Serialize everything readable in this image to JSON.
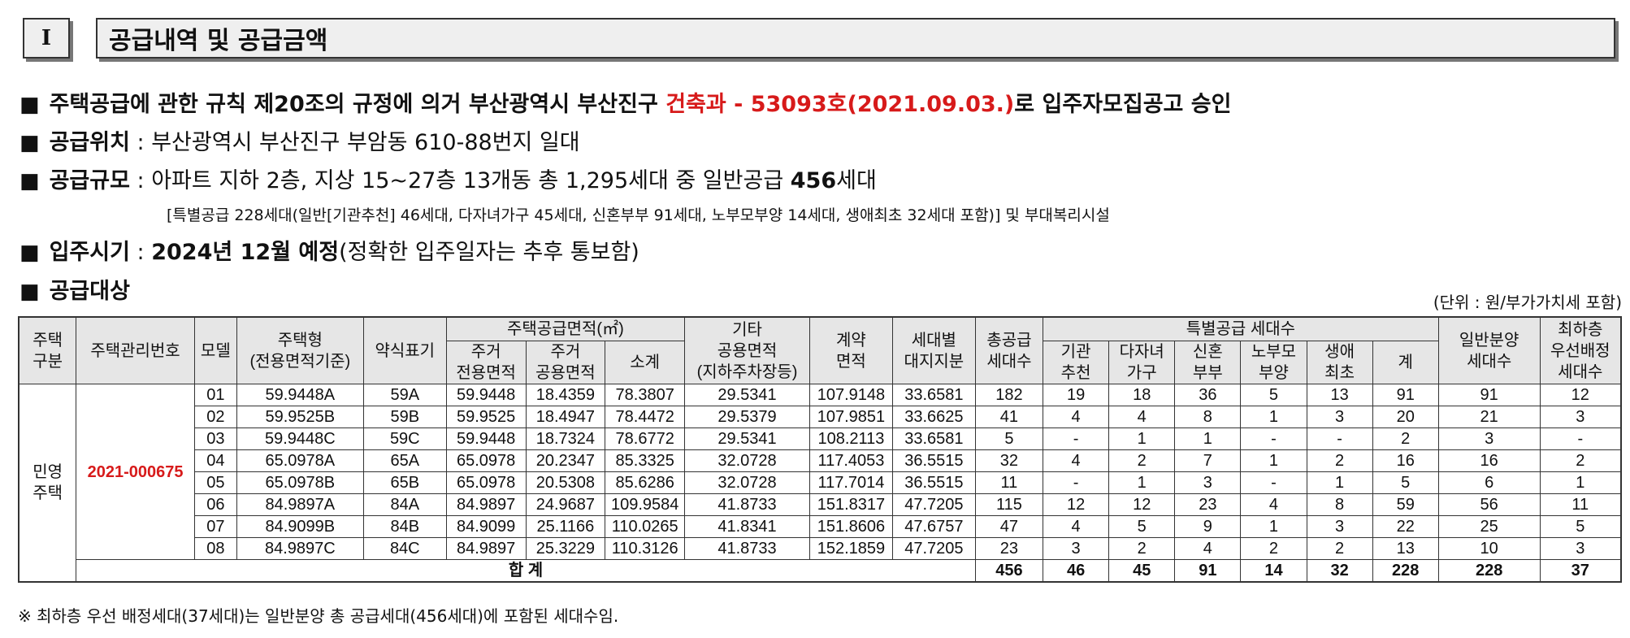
{
  "header": {
    "num": "I",
    "title": "공급내역 및 공급금액"
  },
  "lines": {
    "approval_pre": "주택공급에 관한 규칙 제20조의 규정에 의거 부산광역시 부산진구 ",
    "approval_red": "건축과 - 53093호(2021.09.03.)",
    "approval_post": "로 입주자모집공고 승인",
    "loc_label": "공급위치",
    "loc_text": " : 부산광역시 부산진구 부암동 610-88번지 일대",
    "scale_label": "공급규모",
    "scale_text": " : 아파트 지하 2층, 지상 15~27층 13개동 총 1,295세대 중 일반공급 ",
    "scale_bold": "456",
    "scale_end": "세대",
    "scale_sub": "[특별공급 228세대(일반[기관추천] 46세대, 다자녀가구 45세대, 신혼부부 91세대, 노부모부양 14세대, 생애최초 32세대 포함)] 및 부대복리시설",
    "move_label": "입주시기",
    "move_pre": " : ",
    "move_bold": "2024년 12월 예정",
    "move_text": "(정확한 입주일자는 추후 통보함)",
    "target_label": "공급대상",
    "unit": "(단위 : 원/부가가치세 포함)",
    "square": "■"
  },
  "table": {
    "h": {
      "house_type": "주택\n구분",
      "mgmt_no": "주택관리번호",
      "model": "모델",
      "type": "주택형\n(전용면적기준)",
      "short": "약식표기",
      "area_group": "주택공급면적(㎡)",
      "excl": "주거\n전용면적",
      "common": "주거\n공용면적",
      "subtotal": "소계",
      "other": "기타\n공용면적\n(지하주차장등)",
      "contract": "계약\n면적",
      "land": "세대별\n대지지분",
      "total": "총공급\n세대수",
      "special_group": "특별공급 세대수",
      "inst": "기관\n추천",
      "multi": "다자녀\n가구",
      "newlywed": "신혼\n부부",
      "elder": "노부모\n부양",
      "first": "생애\n최초",
      "sum": "계",
      "general": "일반분양\n세대수",
      "lowest": "최하층\n우선배정\n세대수"
    },
    "house_type": "민영\n주택",
    "mgmt_no": "2021-000675",
    "rows": [
      [
        "01",
        "59.9448A",
        "59A",
        "59.9448",
        "18.4359",
        "78.3807",
        "29.5341",
        "107.9148",
        "33.6581",
        "182",
        "19",
        "18",
        "36",
        "5",
        "13",
        "91",
        "91",
        "12"
      ],
      [
        "02",
        "59.9525B",
        "59B",
        "59.9525",
        "18.4947",
        "78.4472",
        "29.5379",
        "107.9851",
        "33.6625",
        "41",
        "4",
        "4",
        "8",
        "1",
        "3",
        "20",
        "21",
        "3"
      ],
      [
        "03",
        "59.9448C",
        "59C",
        "59.9448",
        "18.7324",
        "78.6772",
        "29.5341",
        "108.2113",
        "33.6581",
        "5",
        "-",
        "1",
        "1",
        "-",
        "-",
        "2",
        "3",
        "-"
      ],
      [
        "04",
        "65.0978A",
        "65A",
        "65.0978",
        "20.2347",
        "85.3325",
        "32.0728",
        "117.4053",
        "36.5515",
        "32",
        "4",
        "2",
        "7",
        "1",
        "2",
        "16",
        "16",
        "2"
      ],
      [
        "05",
        "65.0978B",
        "65B",
        "65.0978",
        "20.5308",
        "85.6286",
        "32.0728",
        "117.7014",
        "36.5515",
        "11",
        "-",
        "1",
        "3",
        "-",
        "1",
        "5",
        "6",
        "1"
      ],
      [
        "06",
        "84.9897A",
        "84A",
        "84.9897",
        "24.9687",
        "109.9584",
        "41.8733",
        "151.8317",
        "47.7205",
        "115",
        "12",
        "12",
        "23",
        "4",
        "8",
        "59",
        "56",
        "11"
      ],
      [
        "07",
        "84.9099B",
        "84B",
        "84.9099",
        "25.1166",
        "110.0265",
        "41.8341",
        "151.8606",
        "47.6757",
        "47",
        "4",
        "5",
        "9",
        "1",
        "3",
        "22",
        "25",
        "5"
      ],
      [
        "08",
        "84.9897C",
        "84C",
        "84.9897",
        "25.3229",
        "110.3126",
        "41.8733",
        "152.1859",
        "47.7205",
        "23",
        "3",
        "2",
        "4",
        "2",
        "2",
        "13",
        "10",
        "3"
      ]
    ],
    "total_label": "합 계",
    "totals": [
      "456",
      "46",
      "45",
      "91",
      "14",
      "32",
      "228",
      "228",
      "37"
    ]
  },
  "note": "※ 최하층 우선 배정세대(37세대)는 일반분양 총 공급세대(456세대)에 포함된 세대수임."
}
